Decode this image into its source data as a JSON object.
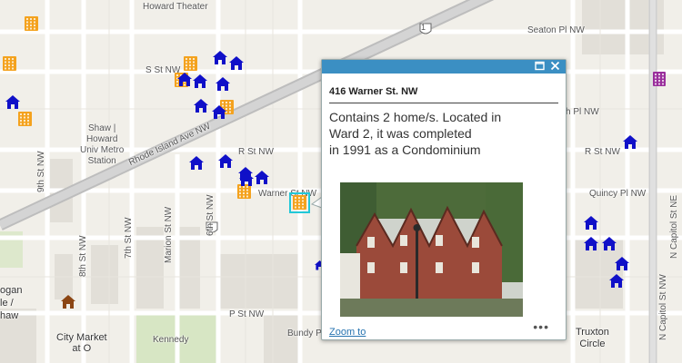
{
  "map": {
    "streets": {
      "howard_theater": "Howard Theater",
      "seaton_pl": "Seaton Pl NW",
      "s_st": "S St NW",
      "r_st": "R St NW",
      "r_st_east": "R St NW",
      "rhode_island": "Rhode Island Ave NW",
      "warner": "Warner St NW",
      "quincy": "Quincy Pl NW",
      "p_st": "P St NW",
      "ninth": "9th St NW",
      "eighth": "8th St NW",
      "seventh": "7th St NW",
      "marion": "Marion St NW",
      "sixth": "6th St NW",
      "n_capitol_nw": "N Capitol St NW",
      "n_capitol_ne": "N Capitol St NE",
      "pl_nw_partial": "h Pl NW",
      "station_1": "Shaw |",
      "station_2": "Howard",
      "station_3": "Univ Metro",
      "station_4": "Station",
      "logan_1": "ogan",
      "logan_2": "le /",
      "logan_3": "haw",
      "city_market_1": "City Market",
      "city_market_2": "at O",
      "kennedy": "Kennedy",
      "bundy": "Bundy P",
      "truxton_1": "Truxton",
      "truxton_2": "Circle",
      "route_shield": "1"
    },
    "colors": {
      "owner_icon": "#1010c8",
      "condo_icon": "#f4a21e",
      "brown_icon": "#8b4513",
      "purple_icon": "#9a2f9c",
      "selection": "#22c8d8",
      "popup_bar": "#3b8fc3"
    }
  },
  "popup": {
    "title": "416 Warner St. NW",
    "desc_line1": "Contains 2 home/s. Located in",
    "desc_line2": "Ward 2, it was completed",
    "desc_line3": "in 1991 as a Condominium",
    "photo_alt": "Photo of brick rowhouses at 416 Warner St. NW",
    "zoom_label": "Zoom to",
    "more_label": "•••",
    "maximize_icon": "maximize-icon",
    "close_icon": "close-icon"
  }
}
